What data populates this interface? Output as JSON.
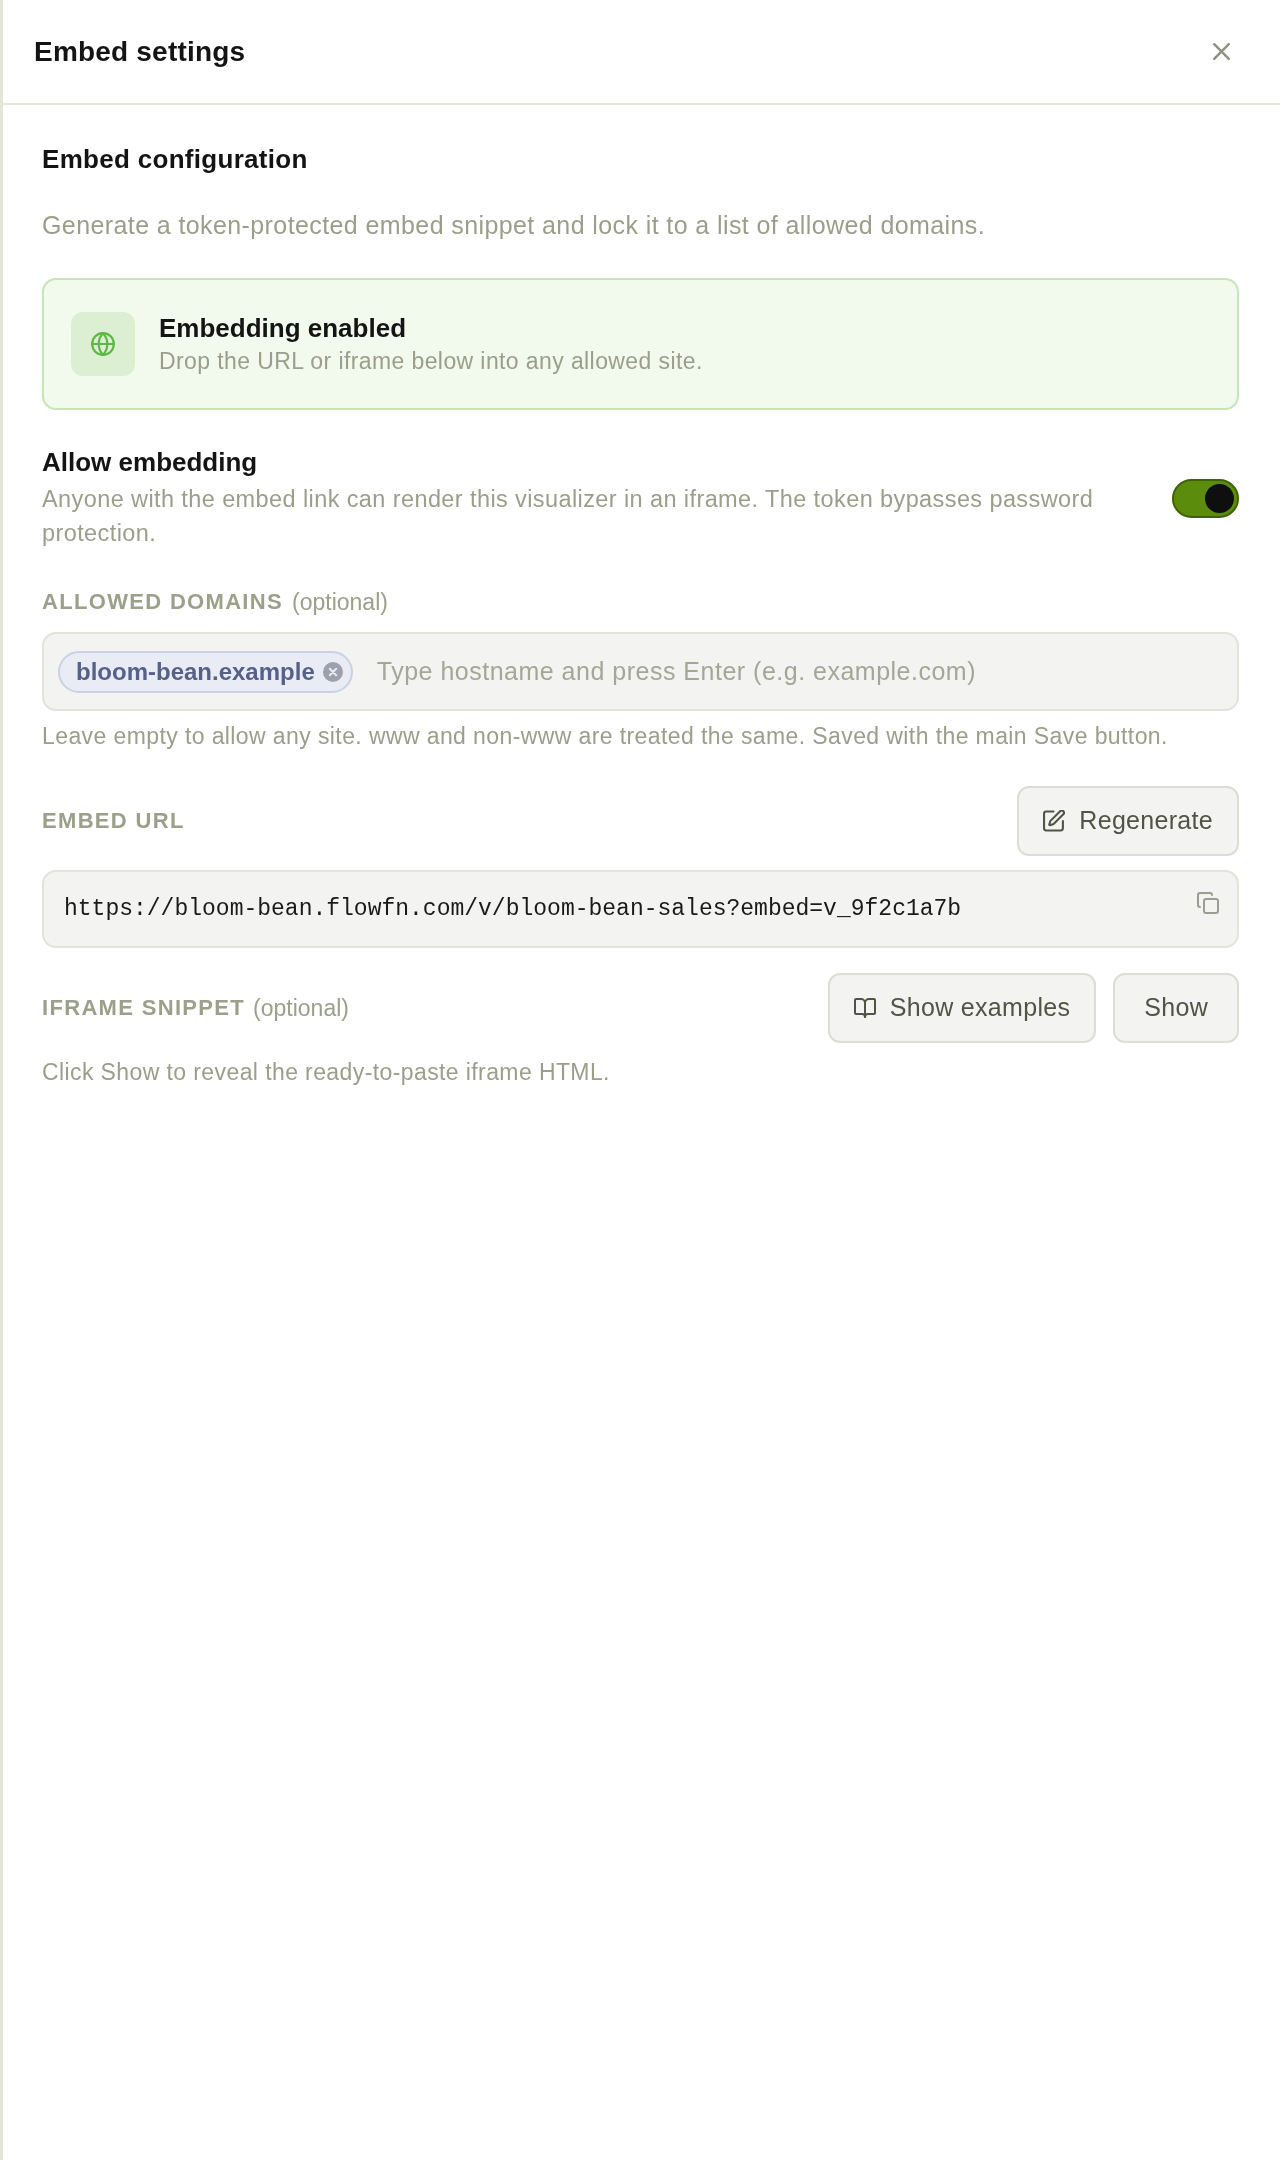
{
  "dialog": {
    "title": "Embed settings"
  },
  "section": {
    "title": "Embed configuration",
    "description": "Generate a token-protected embed snippet and lock it to a list of allowed domains."
  },
  "status_banner": {
    "title": "Embedding enabled",
    "description": "Drop the URL or iframe below into any allowed site."
  },
  "allow_embedding": {
    "label": "Allow embedding",
    "description": "Anyone with the embed link can render this visualizer in an iframe. The token bypasses password protection.",
    "on": true
  },
  "allowed_domains": {
    "label": "ALLOWED DOMAINS",
    "note": "(optional)",
    "tags": [
      "bloom-bean.example"
    ],
    "placeholder": "Type hostname and press Enter (e.g. example.com)",
    "help": "Leave empty to allow any site. www and non-www are treated the same. Saved with the main Save button."
  },
  "embed_url": {
    "label": "EMBED URL",
    "button": "Regenerate",
    "value": "https://bloom-bean.flowfn.com/v/bloom-bean-sales?embed=v_9f2c1a7b"
  },
  "iframe_snippet": {
    "label": "IFRAME SNIPPET",
    "note": "(optional)",
    "buttons": [
      {
        "label": "Show examples",
        "kind": "examples"
      },
      {
        "label": "Show",
        "kind": "plain"
      }
    ],
    "help": "Click Show to reveal the ready-to-paste iframe HTML."
  }
}
